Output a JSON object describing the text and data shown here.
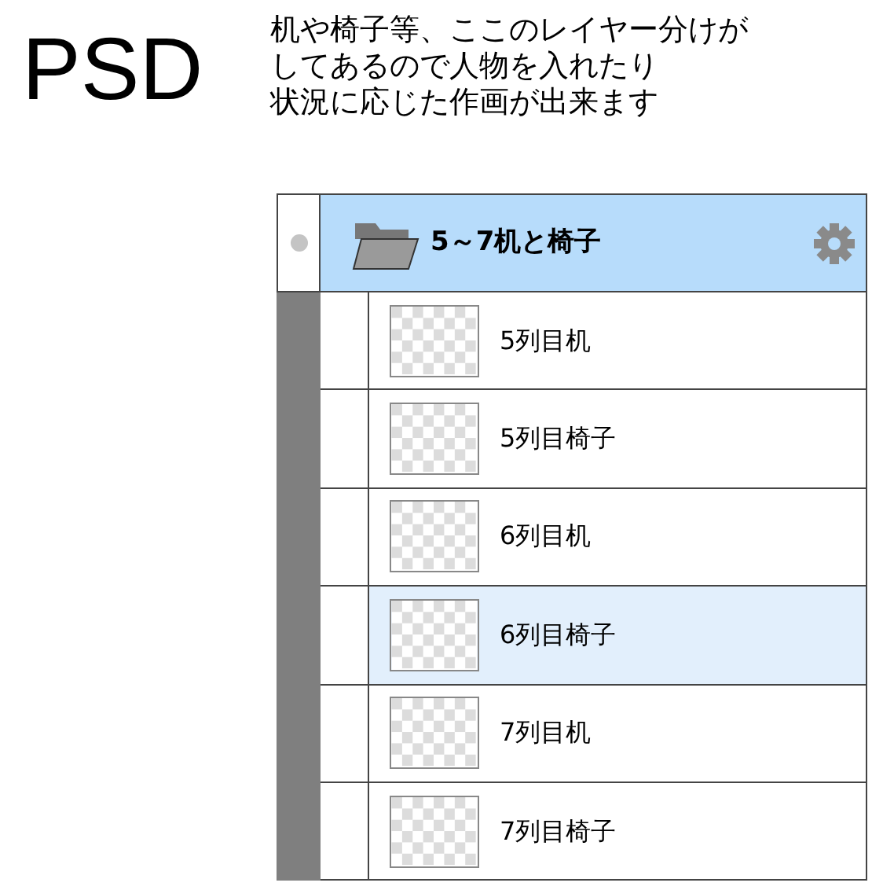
{
  "heading": "PSD",
  "description_lines": [
    "机や椅子等、ここのレイヤー分けが",
    "してあるので人物を入れたり",
    "状況に応じた作画が出来ます"
  ],
  "group": {
    "name": "5～7机と椅子",
    "selected": true,
    "expanded": true
  },
  "layers": [
    {
      "name": "5列目机",
      "selected": false
    },
    {
      "name": "5列目椅子",
      "selected": false
    },
    {
      "name": "6列目机",
      "selected": false
    },
    {
      "name": "6列目椅子",
      "selected": true
    },
    {
      "name": "7列目机",
      "selected": false
    },
    {
      "name": "7列目椅子",
      "selected": false
    }
  ]
}
